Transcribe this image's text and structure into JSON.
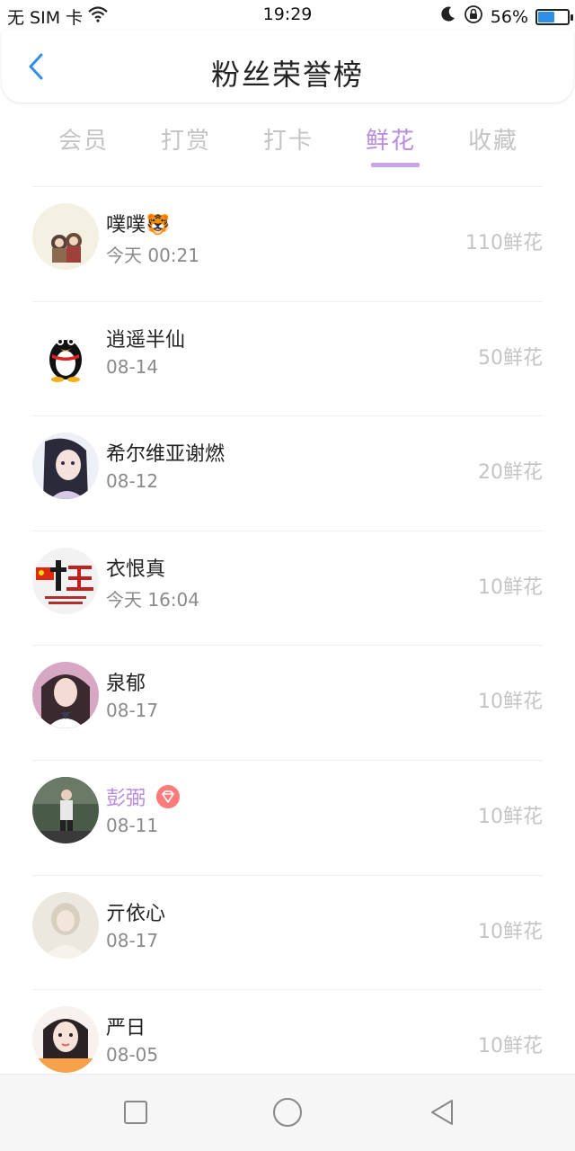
{
  "status_bar": {
    "carrier": "无 SIM 卡",
    "time": "19:29",
    "battery_text": "56%",
    "battery_level": 0.56,
    "icons": [
      "wifi-icon",
      "moon-icon",
      "rotation-lock-icon",
      "battery-icon"
    ]
  },
  "header": {
    "title": "粉丝荣誉榜",
    "back_icon": "chevron-left-icon"
  },
  "tabs": [
    {
      "label": "会员"
    },
    {
      "label": "打赏"
    },
    {
      "label": "打卡"
    },
    {
      "label": "鲜花"
    },
    {
      "label": "收藏"
    }
  ],
  "active_tab": "鲜花",
  "fans": [
    {
      "name": "噗噗🐯",
      "time": "今天 00:21",
      "amount": "110鲜花"
    },
    {
      "name": "逍遥半仙",
      "time": "08-14",
      "amount": "50鲜花"
    },
    {
      "name": "希尔维亚谢燃",
      "time": "08-12",
      "amount": "20鲜花"
    },
    {
      "name": "衣恨真",
      "time": "今天 16:04",
      "amount": "10鲜花"
    },
    {
      "name": "泉郁",
      "time": "08-17",
      "amount": "10鲜花"
    },
    {
      "name": "彭弼",
      "time": "08-11",
      "amount": "10鲜花",
      "vip": true,
      "badge_icon": "diamond-icon"
    },
    {
      "name": "亓依心",
      "time": "08-17",
      "amount": "10鲜花"
    },
    {
      "name": "严日",
      "time": "08-05",
      "amount": "10鲜花"
    }
  ],
  "colors": {
    "accent": "#b98be0",
    "tab_inactive": "#c4c4c4",
    "back_arrow": "#2f8fe8",
    "badge": "#ff7a7a"
  },
  "nav_bar": {
    "icons": [
      "recent-apps-icon",
      "home-icon",
      "back-icon"
    ]
  }
}
